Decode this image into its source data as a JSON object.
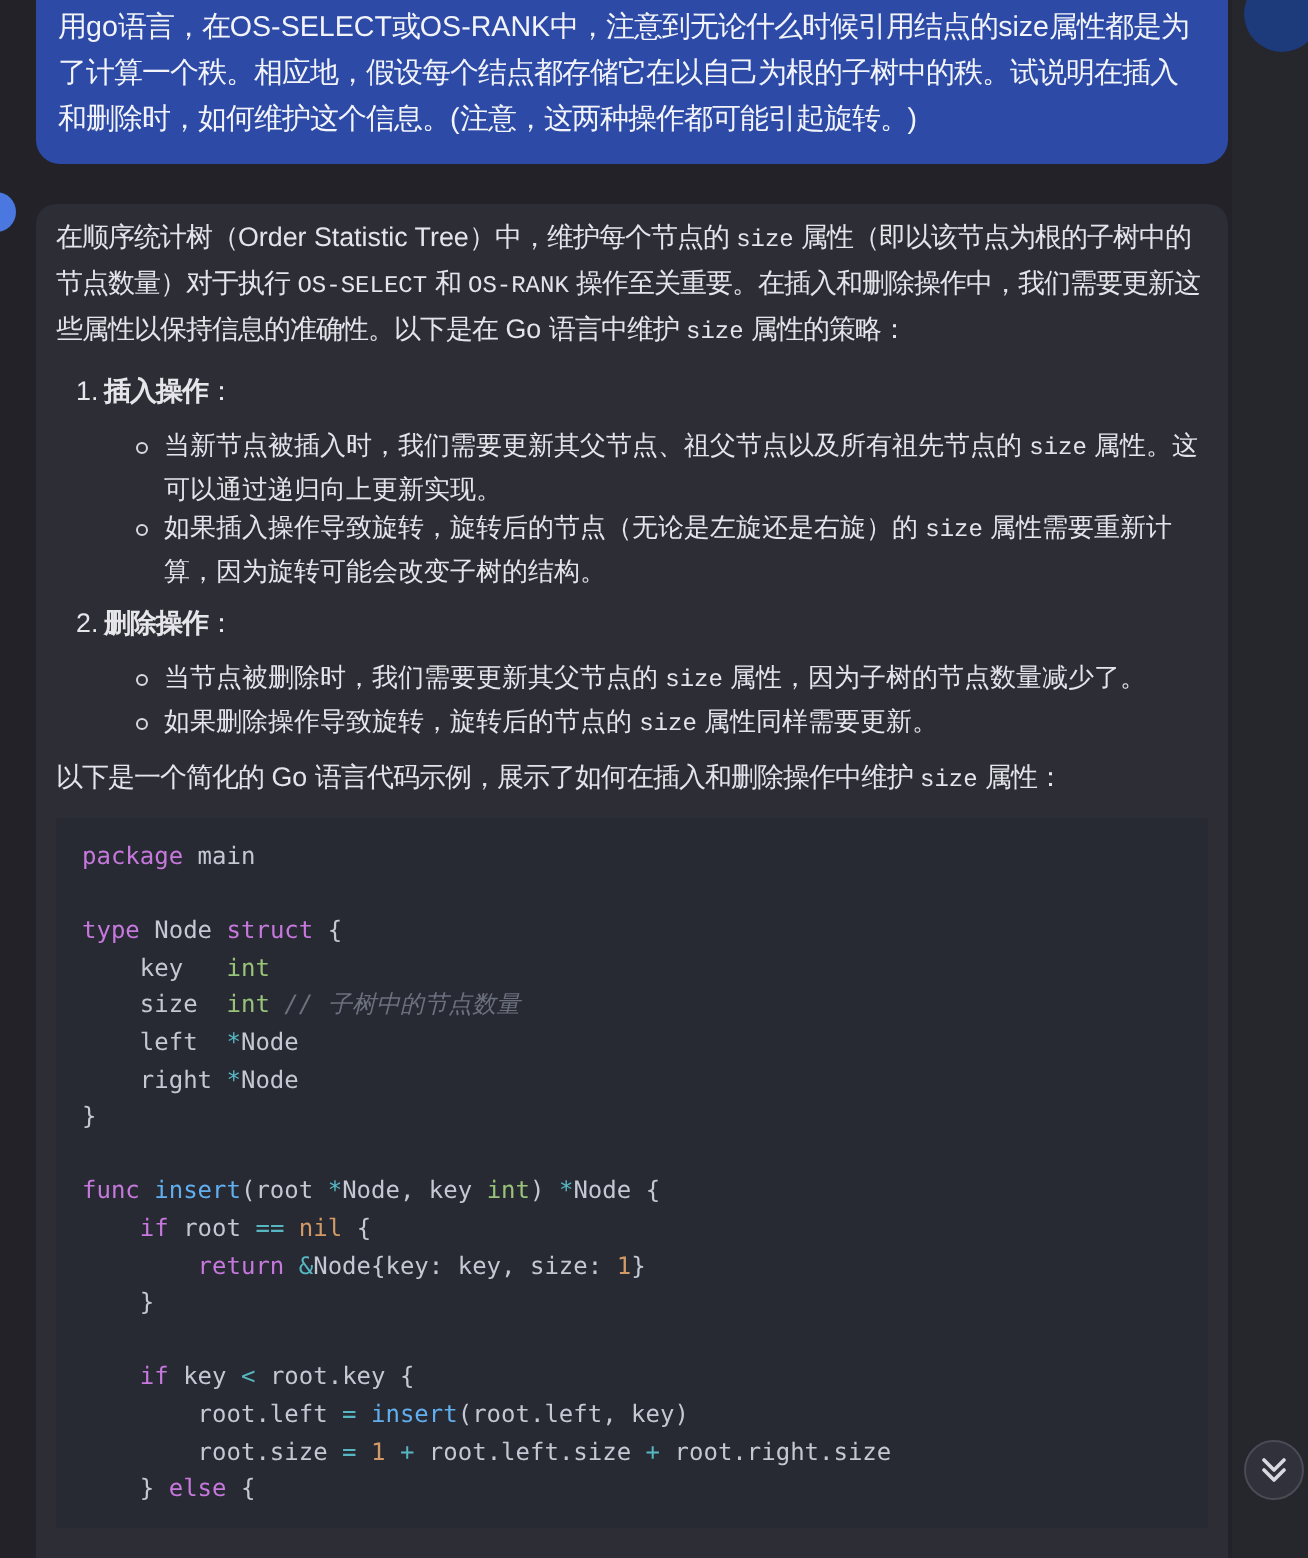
{
  "user_message": {
    "text": "用go语言，在OS-SELECT或OS-RANK中，注意到无论什么时候引用结点的size属性都是为了计算一个秩。相应地，假设每个结点都存储它在以自己为根的子树中的秩。试说明在插入和删除时，如何维护这个信息。(注意，这两种操作都可能引起旋转。)"
  },
  "answer": {
    "blocks": [
      {
        "kind": "paragraph",
        "segments": [
          {
            "kind": "text",
            "text": "在顺序统计树（Order Statistic Tree）中，维护每个节点的 "
          },
          {
            "kind": "code",
            "text": "size"
          },
          {
            "kind": "text",
            "text": " 属性（即以该节点为根的子树中的节点数量）对于执行 "
          },
          {
            "kind": "code",
            "text": "OS-SELECT"
          },
          {
            "kind": "text",
            "text": " 和 "
          },
          {
            "kind": "code",
            "text": "OS-RANK"
          },
          {
            "kind": "text",
            "text": " 操作至关重要。在插入和删除操作中，我们需要更新这些属性以保持信息的准确性。以下是在 Go 语言中维护 "
          },
          {
            "kind": "code",
            "text": "size"
          },
          {
            "kind": "text",
            "text": " 属性的策略："
          }
        ]
      },
      {
        "kind": "list_item",
        "number": "1.",
        "title": "**插入操作**：",
        "bullets": [
          [
            {
              "kind": "text",
              "text": "当新节点被插入时，我们需要更新其父节点、祖父节点以及所有祖先节点的 "
            },
            {
              "kind": "code",
              "text": "size"
            },
            {
              "kind": "text",
              "text": " 属性。这可以通过递归向上更新实现。"
            }
          ],
          [
            {
              "kind": "text",
              "text": "如果插入操作导致旋转，旋转后的节点（无论是左旋还是右旋）的 "
            },
            {
              "kind": "code",
              "text": "size"
            },
            {
              "kind": "text",
              "text": " 属性需要重新计算，因为旋转可能会改变子树的结构。"
            }
          ]
        ]
      },
      {
        "kind": "list_item",
        "number": "2.",
        "title": "**删除操作**：",
        "bullets": [
          [
            {
              "kind": "text",
              "text": "当节点被删除时，我们需要更新其父节点的 "
            },
            {
              "kind": "code",
              "text": "size"
            },
            {
              "kind": "text",
              "text": " 属性，因为子树的节点数量减少了。"
            }
          ],
          [
            {
              "kind": "text",
              "text": "如果删除操作导致旋转，旋转后的节点的 "
            },
            {
              "kind": "code",
              "text": "size"
            },
            {
              "kind": "text",
              "text": " 属性同样需要更新。"
            }
          ]
        ]
      },
      {
        "kind": "paragraph",
        "segments": [
          {
            "kind": "text",
            "text": "以下是一个简化的 Go 语言代码示例，展示了如何在插入和删除操作中维护 "
          },
          {
            "kind": "code",
            "text": "size"
          },
          {
            "kind": "text",
            "text": " 属性："
          }
        ]
      },
      {
        "kind": "code_block",
        "lines": [
          {
            "kind": "code",
            "tokens": [
              {
                "kind": "keyword",
                "text": "package"
              },
              {
                "kind": "plain",
                "text": " main"
              }
            ]
          },
          {
            "kind": "blank"
          },
          {
            "kind": "code",
            "tokens": [
              {
                "kind": "keyword",
                "text": "type"
              },
              {
                "kind": "plain",
                "text": " Node "
              },
              {
                "kind": "keyword",
                "text": "struct"
              },
              {
                "kind": "plain",
                "text": " {"
              }
            ]
          },
          {
            "kind": "code",
            "tokens": [
              {
                "kind": "plain",
                "text": "    key   "
              },
              {
                "kind": "type",
                "text": "int"
              }
            ]
          },
          {
            "kind": "code",
            "tokens": [
              {
                "kind": "plain",
                "text": "    size  "
              },
              {
                "kind": "type",
                "text": "int"
              },
              {
                "kind": "comment",
                "text": " // 子树中的节点数量"
              }
            ]
          },
          {
            "kind": "code",
            "tokens": [
              {
                "kind": "plain",
                "text": "    left  "
              },
              {
                "kind": "operator",
                "text": "*"
              },
              {
                "kind": "plain",
                "text": "Node"
              }
            ]
          },
          {
            "kind": "code",
            "tokens": [
              {
                "kind": "plain",
                "text": "    right "
              },
              {
                "kind": "operator",
                "text": "*"
              },
              {
                "kind": "plain",
                "text": "Node"
              }
            ]
          },
          {
            "kind": "code",
            "tokens": [
              {
                "kind": "plain",
                "text": "}"
              }
            ]
          },
          {
            "kind": "blank"
          },
          {
            "kind": "code",
            "tokens": [
              {
                "kind": "keyword",
                "text": "func "
              },
              {
                "kind": "function",
                "text": "insert"
              },
              {
                "kind": "plain",
                "text": "(root "
              },
              {
                "kind": "operator",
                "text": "*"
              },
              {
                "kind": "plain",
                "text": "Node, key "
              },
              {
                "kind": "type",
                "text": "int"
              },
              {
                "kind": "plain",
                "text": ") "
              },
              {
                "kind": "operator",
                "text": "*"
              },
              {
                "kind": "plain",
                "text": "Node {"
              }
            ]
          },
          {
            "kind": "code",
            "tokens": [
              {
                "kind": "keyword",
                "text": "    if"
              },
              {
                "kind": "plain",
                "text": " root "
              },
              {
                "kind": "operator",
                "text": "== "
              },
              {
                "kind": "number",
                "text": "nil"
              },
              {
                "kind": "plain",
                "text": " {"
              }
            ]
          },
          {
            "kind": "code",
            "tokens": [
              {
                "kind": "keyword",
                "text": "        return "
              },
              {
                "kind": "operator",
                "text": "&"
              },
              {
                "kind": "plain",
                "text": "Node{key: key, size: "
              },
              {
                "kind": "number",
                "text": "1"
              },
              {
                "kind": "plain",
                "text": "}"
              }
            ]
          },
          {
            "kind": "code",
            "tokens": [
              {
                "kind": "plain",
                "text": "    }"
              }
            ]
          },
          {
            "kind": "blank"
          },
          {
            "kind": "code",
            "tokens": [
              {
                "kind": "keyword",
                "text": "    if"
              },
              {
                "kind": "plain",
                "text": " key "
              },
              {
                "kind": "operator",
                "text": "<"
              },
              {
                "kind": "plain",
                "text": " root.key {"
              }
            ]
          },
          {
            "kind": "code",
            "tokens": [
              {
                "kind": "plain",
                "text": "        root.left "
              },
              {
                "kind": "operator",
                "text": "= "
              },
              {
                "kind": "function",
                "text": "insert"
              },
              {
                "kind": "plain",
                "text": "(root.left, key)"
              }
            ]
          },
          {
            "kind": "code",
            "tokens": [
              {
                "kind": "plain",
                "text": "        root.size "
              },
              {
                "kind": "operator",
                "text": "= "
              },
              {
                "kind": "number",
                "text": "1"
              },
              {
                "kind": "operator",
                "text": " + "
              },
              {
                "kind": "plain",
                "text": "root.left.size"
              },
              {
                "kind": "operator",
                "text": " + "
              },
              {
                "kind": "plain",
                "text": "root.right.size"
              }
            ]
          },
          {
            "kind": "code",
            "tokens": [
              {
                "kind": "plain",
                "text": "    } "
              },
              {
                "kind": "keyword",
                "text": "else"
              },
              {
                "kind": "plain",
                "text": " {"
              }
            ]
          }
        ]
      }
    ]
  }
}
